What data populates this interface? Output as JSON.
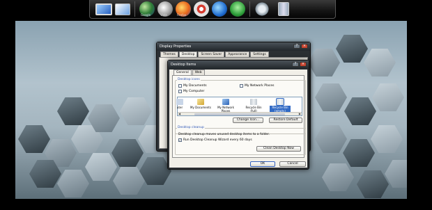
{
  "dock": {
    "items": [
      {
        "icon": "monitor-icon"
      },
      {
        "icon": "window-icon"
      },
      {
        "icon": "globe-icon"
      },
      {
        "icon": "vista-icon"
      },
      {
        "icon": "firefox-icon"
      },
      {
        "icon": "chrome-icon"
      },
      {
        "icon": "media-player-icon"
      },
      {
        "icon": "messenger-icon"
      },
      {
        "icon": "gear-icon"
      },
      {
        "icon": "recycle-bin-icon"
      }
    ],
    "globe_caption": "Google",
    "vista_caption": "Vista",
    "ff_caption": "Firefox"
  },
  "display_properties": {
    "title": "Display Properties",
    "tabs": [
      "Themes",
      "Desktop",
      "Screen Saver",
      "Appearance",
      "Settings"
    ],
    "active_tab": "Desktop"
  },
  "desktop_items": {
    "title": "Desktop Items",
    "tabs": [
      "General",
      "Web"
    ],
    "active_tab": "General",
    "desktop_icons_group": "Desktop icons",
    "checkboxes": [
      {
        "label": "My Documents",
        "checked": false
      },
      {
        "label": "My Network Places",
        "checked": false
      },
      {
        "label": "My Computer",
        "checked": false
      }
    ],
    "icon_list": [
      {
        "label": "uter"
      },
      {
        "label": "My Documents"
      },
      {
        "label": "My Network Places"
      },
      {
        "label": "Recycle Bin (full)"
      },
      {
        "label": "Recycle Bin (empty)",
        "selected": true
      }
    ],
    "change_icon_button": "Change Icon...",
    "restore_default_button": "Restore Default",
    "cleanup_group": "Desktop cleanup",
    "cleanup_desc": "Desktop cleanup moves unused desktop items to a folder.",
    "cleanup_checkbox": "Run Desktop Cleanup Wizard every 60 days",
    "cleanup_checked": true,
    "clean_now_button": "Clean Desktop Now",
    "ok_button": "OK",
    "cancel_button": "Cancel"
  },
  "colors": {
    "selection": "#316ac5",
    "group_title": "#2b54b5"
  }
}
